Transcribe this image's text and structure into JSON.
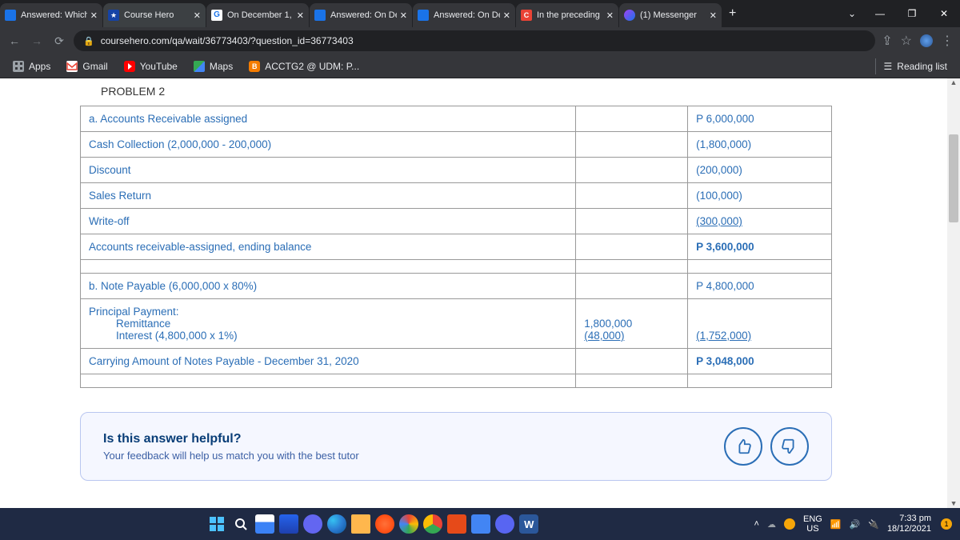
{
  "window": {
    "tabs": [
      {
        "label": "Answered: Which",
        "favcolor": "#1a73e8"
      },
      {
        "label": "Course Hero",
        "favcolor": "#1543a6"
      },
      {
        "label": "On December 1,",
        "favcolor": "#1a73e8"
      },
      {
        "label": "Answered: On De",
        "favcolor": "#1a73e8"
      },
      {
        "label": "Answered: On De",
        "favcolor": "#1a73e8"
      },
      {
        "label": "In the preceding",
        "favcolor": "#ea4335"
      },
      {
        "label": "(1) Messenger",
        "favcolor": "#a142f4"
      }
    ],
    "url": "coursehero.com/qa/wait/36773403/?question_id=36773403"
  },
  "bookmarks": {
    "apps": "Apps",
    "gmail": "Gmail",
    "youtube": "YouTube",
    "maps": "Maps",
    "acctg": "ACCTG2 @ UDM: P...",
    "reading": "Reading list"
  },
  "page": {
    "problem_title": "PROBLEM 2",
    "rows": [
      {
        "label": "a. Accounts Receivable assigned",
        "mid": "",
        "val": "P 6,000,000",
        "bold": false
      },
      {
        "label": "Cash Collection (2,000,000 - 200,000)",
        "mid": "",
        "val": "(1,800,000)"
      },
      {
        "label": "Discount",
        "mid": "",
        "val": "(200,000)"
      },
      {
        "label": "Sales Return",
        "mid": "",
        "val": "(100,000)"
      },
      {
        "label": "Write-off",
        "mid": "",
        "val": "(300,000)",
        "und": true
      },
      {
        "label": "Accounts receivable-assigned, ending balance",
        "mid": "",
        "val": "P 3,600,000",
        "bold": true
      },
      {
        "label": "",
        "mid": "",
        "val": ""
      },
      {
        "label": "b. Note Payable (6,000,000 x 80%)",
        "mid": "",
        "val": "P 4,800,000"
      }
    ],
    "pp_label": "Principal Payment:",
    "pp_remit": "Remittance",
    "pp_remit_mid": "1,800,000",
    "pp_int": "Interest (4,800,000 x 1%)",
    "pp_int_mid": "(48,000)",
    "pp_val": "(1,752,000)",
    "carry_label": "Carrying Amount of Notes Payable - December 31, 2020",
    "carry_val": "P 3,048,000",
    "empty": ""
  },
  "feedback": {
    "heading": "Is this answer helpful?",
    "sub": "Your feedback will help us match you with the best tutor"
  },
  "tray": {
    "lang1": "ENG",
    "lang2": "US",
    "time": "7:33 pm",
    "date": "18/12/2021"
  },
  "syms": {
    "close": "✕",
    "plus": "+",
    "min": "—",
    "max": "❐",
    "chev": "⌄",
    "back": "←",
    "fwd": "→",
    "reload": "⟳",
    "lock": "🔒",
    "share": "⇪",
    "star": "☆",
    "dots": "⋮",
    "thumb_up": "👍",
    "thumb_down": "👎",
    "up": "▲",
    "wifi": "⋰",
    "spk": "🔊",
    "bat": "🔌",
    "caret": "˄"
  }
}
